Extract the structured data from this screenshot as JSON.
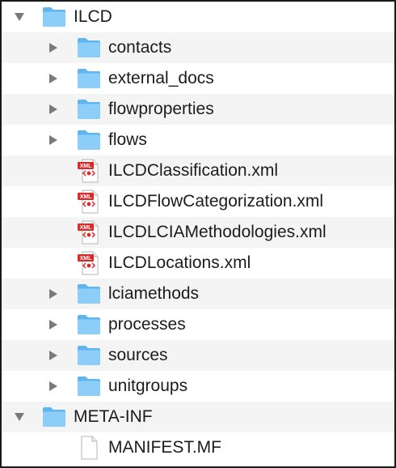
{
  "tree": {
    "root_ilcd": {
      "label": "ILCD",
      "expanded": true,
      "icon": "folder-icon"
    },
    "contacts": {
      "label": "contacts",
      "expanded": false,
      "icon": "folder-icon"
    },
    "external_docs": {
      "label": "external_docs",
      "expanded": false,
      "icon": "folder-icon"
    },
    "flowproperties": {
      "label": "flowproperties",
      "expanded": false,
      "icon": "folder-icon"
    },
    "flows": {
      "label": "flows",
      "expanded": false,
      "icon": "folder-icon"
    },
    "classification": {
      "label": "ILCDClassification.xml",
      "icon": "xml-file-icon",
      "badge": "XML"
    },
    "flow_categorization": {
      "label": "ILCDFlowCategorization.xml",
      "icon": "xml-file-icon",
      "badge": "XML"
    },
    "lcia_methodologies": {
      "label": "ILCDLCIAMethodologies.xml",
      "icon": "xml-file-icon",
      "badge": "XML"
    },
    "locations": {
      "label": "ILCDLocations.xml",
      "icon": "xml-file-icon",
      "badge": "XML"
    },
    "lciamethods": {
      "label": "lciamethods",
      "expanded": false,
      "icon": "folder-icon"
    },
    "processes": {
      "label": "processes",
      "expanded": false,
      "icon": "folder-icon"
    },
    "sources": {
      "label": "sources",
      "expanded": false,
      "icon": "folder-icon"
    },
    "unitgroups": {
      "label": "unitgroups",
      "expanded": false,
      "icon": "folder-icon"
    },
    "root_meta_inf": {
      "label": "META-INF",
      "expanded": true,
      "icon": "folder-icon"
    },
    "manifest": {
      "label": "MANIFEST.MF",
      "icon": "document-icon"
    }
  },
  "colors": {
    "folder_back": "#5fb6ef",
    "folder_front": "#8ccef8",
    "xml_badge": "#d92b2b",
    "alternate_row": "#f4f4f4",
    "disclosure": "#7a7a7a"
  }
}
